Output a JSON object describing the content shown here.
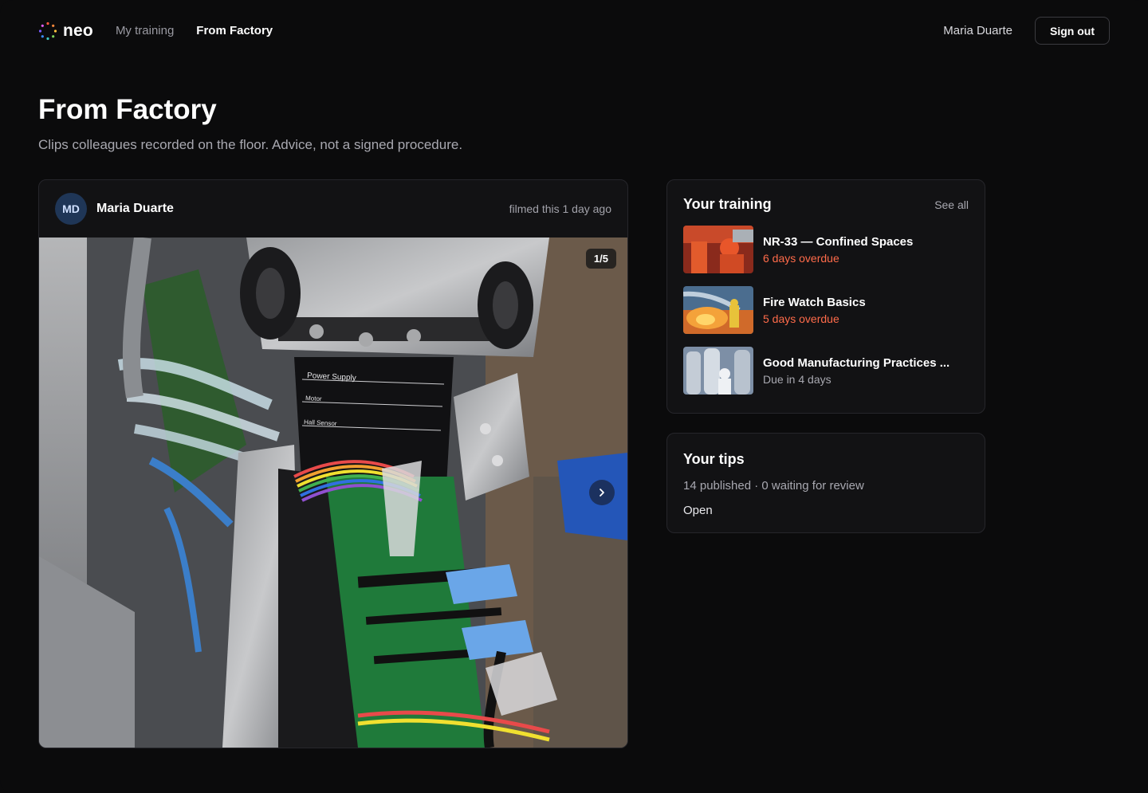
{
  "brand": {
    "name": "neo"
  },
  "nav": {
    "links": [
      {
        "label": "My training",
        "active": false
      },
      {
        "label": "From Factory",
        "active": true
      }
    ],
    "user_name": "Maria Duarte",
    "signout_label": "Sign out"
  },
  "header": {
    "title": "From Factory",
    "subtitle": "Clips colleagues recorded on the floor. Advice, not a signed procedure."
  },
  "post": {
    "author_initials": "MD",
    "author_name": "Maria Duarte",
    "filmed": "filmed this 1 day ago",
    "counter": "1/5",
    "next_icon": "chevron-right-icon",
    "panel_labels": [
      "Power Supply",
      "Motor",
      "Hall Sensor"
    ]
  },
  "training": {
    "title": "Your training",
    "see_all": "See all",
    "items": [
      {
        "title": "NR-33 — Confined Spaces",
        "status": "6 days overdue",
        "state": "overdue"
      },
      {
        "title": "Fire Watch Basics",
        "status": "5 days overdue",
        "state": "overdue"
      },
      {
        "title": "Good Manufacturing Practices ...",
        "status": "Due in 4 days",
        "state": "due"
      }
    ]
  },
  "tips": {
    "title": "Your tips",
    "stats": "14 published · 0 waiting for review",
    "open_label": "Open"
  },
  "colors": {
    "background": "#0b0b0c",
    "card": "#121214",
    "overdue": "#ff6b4a",
    "avatar": "#1f3657"
  }
}
